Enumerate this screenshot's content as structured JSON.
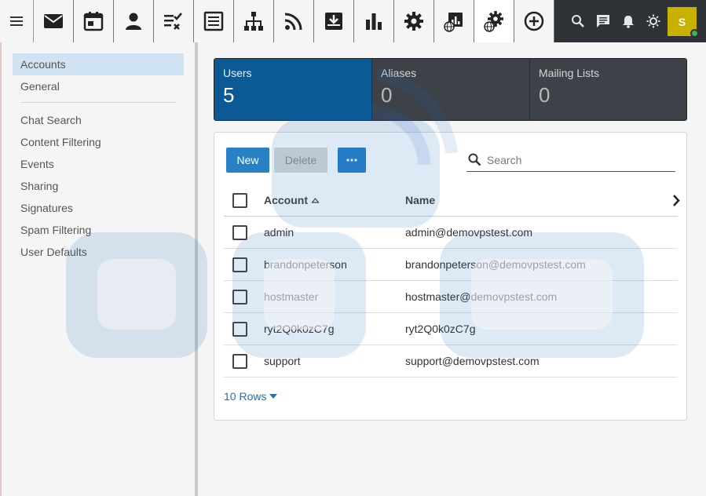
{
  "topbar": {
    "menu_icon": "hamburger-menu-icon",
    "apps": [
      {
        "name": "mail",
        "icon": "envelope-icon"
      },
      {
        "name": "calendar",
        "icon": "calendar-icon"
      },
      {
        "name": "contacts",
        "icon": "person-icon"
      },
      {
        "name": "tasks",
        "icon": "tasks-check-icon"
      },
      {
        "name": "notes",
        "icon": "notes-icon"
      },
      {
        "name": "organization",
        "icon": "org-chart-icon"
      },
      {
        "name": "feeds",
        "icon": "rss-icon"
      },
      {
        "name": "archive",
        "icon": "inbox-download-icon"
      },
      {
        "name": "reports",
        "icon": "bar-chart-icon"
      },
      {
        "name": "settings",
        "icon": "gear-icon"
      },
      {
        "name": "domain-reports",
        "icon": "globe-report-icon"
      },
      {
        "name": "domain-settings",
        "icon": "globe-gear-icon",
        "active": true
      },
      {
        "name": "add",
        "icon": "plus-circle-icon"
      }
    ],
    "tools": [
      "search-icon",
      "chat-icon",
      "bell-icon",
      "brightness-icon"
    ],
    "avatar_initial": "S",
    "avatar_color": "#c9b100",
    "status_color": "#3cb34a"
  },
  "sidebar": {
    "items": [
      {
        "label": "Accounts",
        "selected": true
      },
      {
        "label": "General"
      },
      {
        "label": "Chat Search"
      },
      {
        "label": "Content Filtering"
      },
      {
        "label": "Events"
      },
      {
        "label": "Sharing"
      },
      {
        "label": "Signatures"
      },
      {
        "label": "Spam Filtering"
      },
      {
        "label": "User Defaults"
      }
    ]
  },
  "stats": [
    {
      "label": "Users",
      "count": "5",
      "active": true
    },
    {
      "label": "Aliases",
      "count": "0"
    },
    {
      "label": "Mailing Lists",
      "count": "0"
    }
  ],
  "toolbar": {
    "new_label": "New",
    "delete_label": "Delete",
    "more_icon": "ellipsis-icon",
    "search_placeholder": "Search"
  },
  "table": {
    "columns": [
      "Account",
      "Name"
    ],
    "sort_column": "Account",
    "rows": [
      {
        "account": "admin",
        "name": "admin@demovpstest.com"
      },
      {
        "account": "brandonpeterson",
        "name": "brandonpeterson@demovpstest.com"
      },
      {
        "account": "hostmaster",
        "name": "hostmaster@demovpstest.com"
      },
      {
        "account": "ryt2Q0k0zC7g",
        "name": "ryt2Q0k0zC7g"
      },
      {
        "account": "support",
        "name": "support@demovpstest.com"
      }
    ]
  },
  "pagination": {
    "rows_label": "10 Rows"
  },
  "colors": {
    "accent": "#2880c5",
    "active_stat": "#0b5a96",
    "topbar": "#2f3237"
  }
}
